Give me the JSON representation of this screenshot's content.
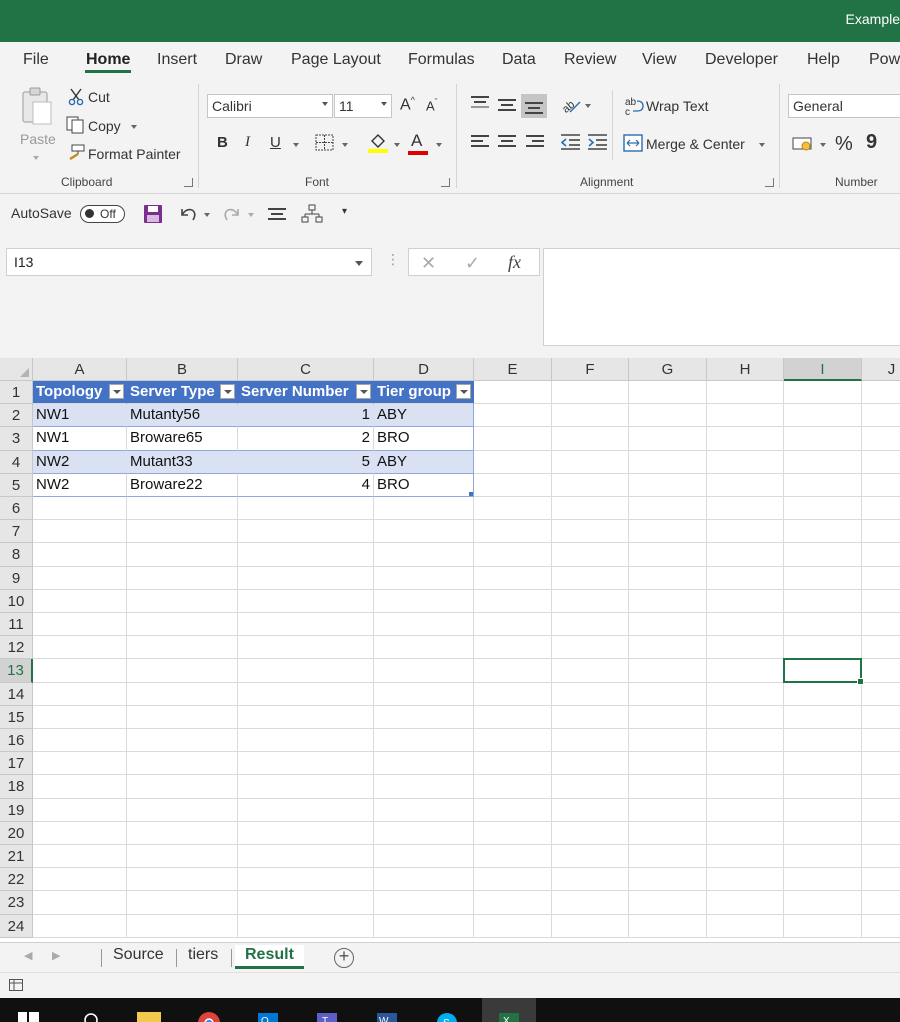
{
  "window": {
    "title": "Example"
  },
  "menu": {
    "tabs": [
      "File",
      "Home",
      "Insert",
      "Draw",
      "Page Layout",
      "Formulas",
      "Data",
      "Review",
      "View",
      "Developer",
      "Help",
      "Pow"
    ],
    "active": "Home"
  },
  "ribbon": {
    "clipboard": {
      "paste": "Paste",
      "cut": "Cut",
      "copy": "Copy",
      "format_painter": "Format Painter",
      "label": "Clipboard"
    },
    "font": {
      "name": "Calibri",
      "size": "11",
      "bold": "B",
      "italic": "I",
      "underline": "U",
      "font_color_glyph": "A",
      "grow_glyph": "A",
      "shrink_glyph": "A",
      "label": "Font"
    },
    "alignment": {
      "wrap_text": "Wrap Text",
      "merge_center": "Merge & Center",
      "label": "Alignment"
    },
    "number": {
      "format": "General",
      "percent": "%",
      "comma": "9",
      "label": "Number"
    }
  },
  "quick_access": {
    "autosave": "AutoSave",
    "autosave_state": "Off"
  },
  "formula_bar": {
    "name_box": "I13",
    "fx": "fx",
    "formula": ""
  },
  "grid": {
    "columns": [
      "A",
      "B",
      "C",
      "D",
      "E",
      "F",
      "G",
      "H",
      "I",
      "J"
    ],
    "rows": [
      "1",
      "2",
      "3",
      "4",
      "5",
      "6",
      "7",
      "8",
      "9",
      "10",
      "11",
      "12",
      "13",
      "14",
      "15",
      "16",
      "17",
      "18",
      "19",
      "20",
      "21",
      "22",
      "23",
      "24"
    ],
    "selected_cell": "I13"
  },
  "table": {
    "headers": [
      "Topology",
      "Server Type",
      "Server Number",
      "Tier group"
    ],
    "rows": [
      [
        "NW1",
        "Mutanty56",
        "1",
        "ABY"
      ],
      [
        "NW1",
        "Broware65",
        "2",
        "BRO"
      ],
      [
        "NW2",
        "Mutant33",
        "5",
        "ABY"
      ],
      [
        "NW2",
        "Broware22",
        "4",
        "BRO"
      ]
    ]
  },
  "sheets": {
    "tabs": [
      "Source",
      "tiers",
      "Result"
    ],
    "active": "Result"
  },
  "colors": {
    "excel_green": "#217346",
    "table_header": "#4472c4",
    "table_band": "#d9e1f2"
  }
}
